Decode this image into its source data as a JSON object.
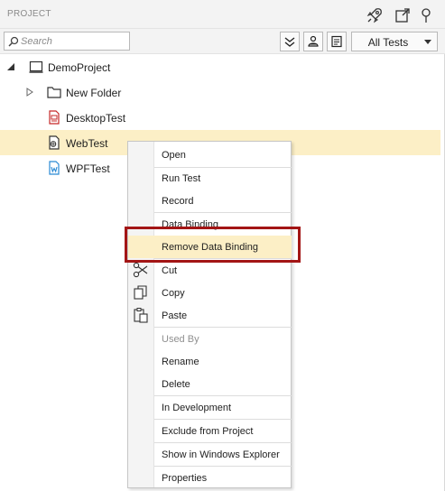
{
  "panel": {
    "title": "PROJECT",
    "header_icons": [
      "rocket-icon",
      "external-link-icon",
      "pin-icon"
    ]
  },
  "toolbar": {
    "search_placeholder": "Search",
    "buttons": [
      "collapse-all-icon",
      "user-filter-icon",
      "document-list-icon"
    ],
    "filter_selected": "All Tests"
  },
  "tree": {
    "root": {
      "label": "DemoProject",
      "icon": "project-icon",
      "expanded": true
    },
    "items": [
      {
        "label": "New Folder",
        "icon": "folder-icon",
        "expandable": true
      },
      {
        "label": "DesktopTest",
        "icon": "desktop-test-icon"
      },
      {
        "label": "WebTest",
        "icon": "web-test-icon",
        "selected": true
      },
      {
        "label": "WPFTest",
        "icon": "wpf-test-icon"
      }
    ],
    "selected_color": "#fcefc6"
  },
  "context_menu": {
    "items": {
      "open": "Open",
      "run_test": "Run Test",
      "record": "Record",
      "data_binding": "Data Binding",
      "remove_data_binding": "Remove Data Binding",
      "cut": "Cut",
      "copy": "Copy",
      "paste": "Paste",
      "used_by": "Used By",
      "rename": "Rename",
      "delete": "Delete",
      "in_development": "In Development",
      "exclude_from_project": "Exclude from Project",
      "show_in_explorer": "Show in Windows Explorer",
      "properties": "Properties"
    },
    "highlighted": "remove_data_binding",
    "disabled": [
      "used_by"
    ],
    "highlight_box_color": "#a31515"
  }
}
